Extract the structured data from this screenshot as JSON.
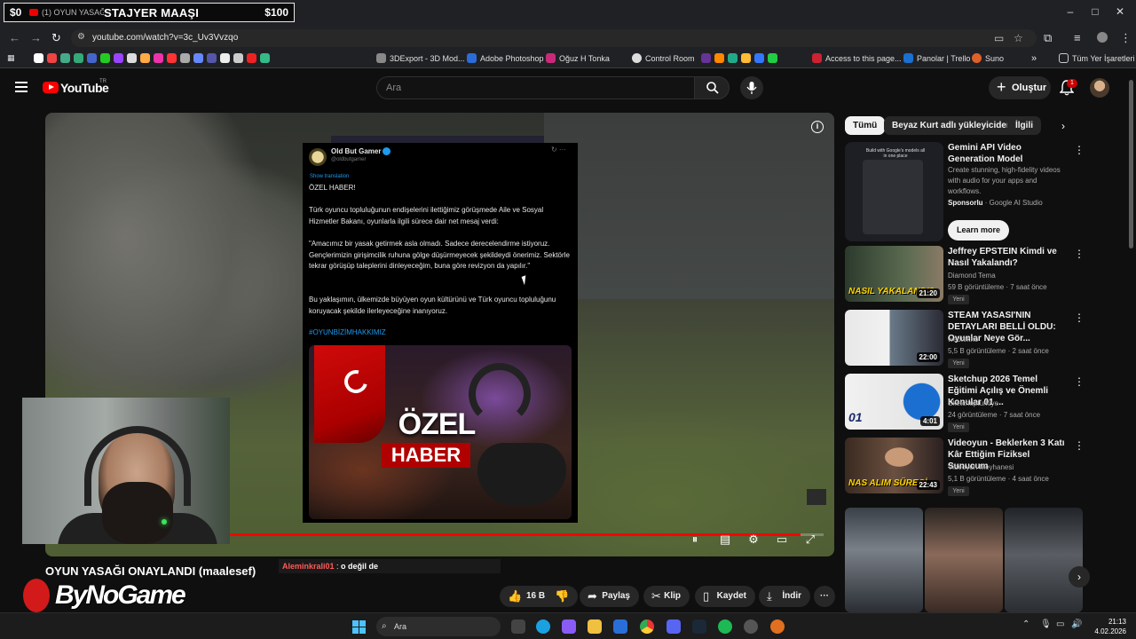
{
  "browser": {
    "tab": {
      "dollar_left": "$0",
      "title": "(1) OYUN YASAĞI O",
      "overlay_text": "STAJYER MAAŞI",
      "dollar_right": "$100"
    },
    "window_controls": [
      "–",
      "□",
      "✕"
    ],
    "url": "youtube.com/watch?v=3c_Uv3Vvzqo",
    "bookmarks": [
      {
        "label": "3DExport - 3D Mod...",
        "icon": "3dexport-icon",
        "color": "#888888"
      },
      {
        "label": "Adobe Photoshop",
        "icon": "photoshop-icon",
        "color": "#2b6cd8"
      },
      {
        "label": "Oğuz H Tonka",
        "icon": "behance-icon",
        "color": "#c82a7a"
      },
      {
        "label": "Control Room",
        "icon": "control-room-icon",
        "color": "#dddddd"
      },
      {
        "label": "Access to this page...",
        "icon": "access-icon",
        "color": "#cc2233"
      },
      {
        "label": "Panolar | Trello",
        "icon": "trello-icon",
        "color": "#1a6fd0"
      },
      {
        "label": "Suno",
        "icon": "suno-icon",
        "color": "#e0602a"
      }
    ],
    "all_bookmarks_label": "Tüm Yer İşaretleri"
  },
  "youtube": {
    "logo_text": "YouTube",
    "country_code": "TR",
    "search_placeholder": "Ara",
    "create_label": "Oluştur",
    "notification_count": "1",
    "video": {
      "title": "OYUN YASAĞI ONAYLANDI (maalesef)",
      "progress": 0.97,
      "tweet": {
        "author": "Old But Gamer",
        "handle": "@oldbutgamer",
        "translate": "Show translation",
        "headline": "ÖZEL HABER!",
        "p1": "Türk oyuncu topluluğunun endişelerini ilettiğimiz görüşmede Aile ve Sosyal Hizmetler Bakanı, oyunlarla ilgili sürece dair net mesaj verdi:",
        "p2": "\"Amacımız bir yasak getirmek asla olmadı. Sadece derecelendirme istiyoruz. Gençlerimizin girişimcilik ruhuna gölge düşürmeyecek şekildeydi önerimiz. Sektörle tekrar görüşüp taleplerini dinleyeceğim, buna göre revizyon da yapılır.\"",
        "p3": "Bu yaklaşımın, ülkemizde büyüyen oyun kültürünü ve Türk oyuncu topluluğunu koruyacak şekilde ilerleyeceğine inanıyoruz.",
        "hashtag": "#OYUNBİZİMHAKKIMIZ",
        "image_title_1": "ÖZEL",
        "image_title_2": "HABER"
      }
    },
    "chat": {
      "user": "Aleminkrali01",
      "separator": " : ",
      "text": "o değil de"
    },
    "brand_overlay": "ByNoGame",
    "actions": {
      "like_count": "16 B",
      "share": "Paylaş",
      "clip": "Klip",
      "save": "Kaydet",
      "download": "İndir"
    },
    "chips": [
      "Tümü",
      "Beyaz Kurt adlı yükleyiciden",
      "İlgili"
    ],
    "ad": {
      "card_text": "Build with Google's models all in one place",
      "title": "Gemini API Video Generation Model",
      "description": "Create stunning, high-fidelity videos with audio for your apps and workflows.",
      "sponsor_label": "Sponsorlu",
      "sponsor": "Google AI Studio",
      "cta": "Learn more"
    },
    "recommendations": [
      {
        "title": "Jeffrey EPSTEIN Kimdi ve Nasıl Yakalandı?",
        "channel": "Diamond Tema",
        "meta": "59 B görüntüleme · 7 saat önce",
        "badge": "Yeni",
        "duration": "21:20",
        "thumb_text": "NASIL YAKALANDI?",
        "thumb_color": "#3a4a3a"
      },
      {
        "title": "STEAM YASASI'NIN DETAYLARI BELLİ OLDU: Oyunlar Neye Gör...",
        "channel": "webtekno",
        "meta": "5,5 B görüntüleme · 2 saat önce",
        "badge": "Yeni",
        "duration": "22:00",
        "thumb_text": "",
        "thumb_color": "#d8d8d8"
      },
      {
        "title": "Sketchup 2026 Temel Eğitimi Açılış ve Önemli Konular 01 ...",
        "channel": "Sketchupturkiye",
        "meta": "24 görüntüleme · 7 saat önce",
        "badge": "Yeni",
        "duration": "4:01",
        "thumb_text": "01",
        "thumb_color": "#e8e8e8"
      },
      {
        "title": "Videoyun - Beklerken 3 Katı Kâr Ettiğim Fiziksel Sunucum",
        "channel": "Videoyun Meyhanesi",
        "meta": "5,1 B görüntüleme · 4 saat önce",
        "badge": "Yeni",
        "duration": "22:43",
        "thumb_text": "NAS ALIM SÜRECİ",
        "thumb_color": "#4a3a2a"
      }
    ]
  },
  "taskbar": {
    "search_placeholder": "Ara",
    "time": "21:13",
    "date": "4.02.2026"
  }
}
